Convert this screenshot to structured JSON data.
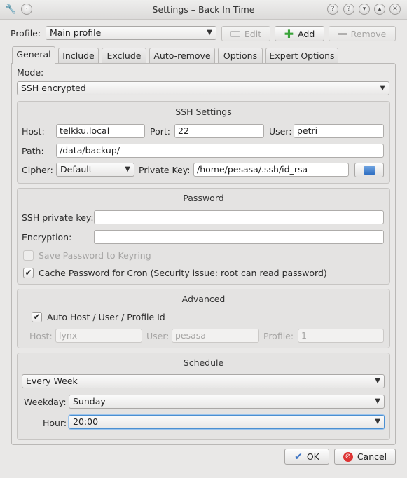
{
  "window": {
    "title": "Settings – Back In Time",
    "buttons": [
      "?",
      "▾",
      "▴",
      "✕"
    ]
  },
  "profile": {
    "label": "Profile:",
    "selected": "Main profile",
    "edit_label": "Edit",
    "add_label": "Add",
    "remove_label": "Remove"
  },
  "tabs": [
    {
      "label": "General"
    },
    {
      "label": "Include"
    },
    {
      "label": "Exclude"
    },
    {
      "label": "Auto-remove"
    },
    {
      "label": "Options"
    },
    {
      "label": "Expert Options"
    }
  ],
  "mode": {
    "label": "Mode:",
    "selected": "SSH encrypted"
  },
  "ssh": {
    "title": "SSH Settings",
    "host_label": "Host:",
    "host_value": "telkku.local",
    "port_label": "Port:",
    "port_value": "22",
    "user_label": "User:",
    "user_value": "petri",
    "path_label": "Path:",
    "path_value": "/data/backup/",
    "cipher_label": "Cipher:",
    "cipher_value": "Default",
    "key_label": "Private Key:",
    "key_value": "/home/pesasa/.ssh/id_rsa"
  },
  "password": {
    "title": "Password",
    "ssh_key_label": "SSH private key:",
    "ssh_key_value": "",
    "encryption_label": "Encryption:",
    "encryption_value": "",
    "save_keyring_label": "Save Password to Keyring",
    "cache_cron_label": "Cache Password for Cron (Security issue: root can read password)"
  },
  "advanced": {
    "title": "Advanced",
    "auto_label": "Auto Host / User / Profile Id",
    "host_label": "Host:",
    "host_value": "lynx",
    "user_label": "User:",
    "user_value": "pesasa",
    "profile_label": "Profile:",
    "profile_value": "1"
  },
  "schedule": {
    "title": "Schedule",
    "frequency": "Every Week",
    "weekday_label": "Weekday:",
    "weekday_value": "Sunday",
    "hour_label": "Hour:",
    "hour_value": "20:00"
  },
  "footer": {
    "ok_label": "OK",
    "cancel_label": "Cancel"
  },
  "colors": {
    "background": "#e9e8e7",
    "accent_focus": "#4b8fd1",
    "add_green": "#3aa33a",
    "ok_blue": "#3b73c4",
    "cancel_red": "#d33"
  }
}
